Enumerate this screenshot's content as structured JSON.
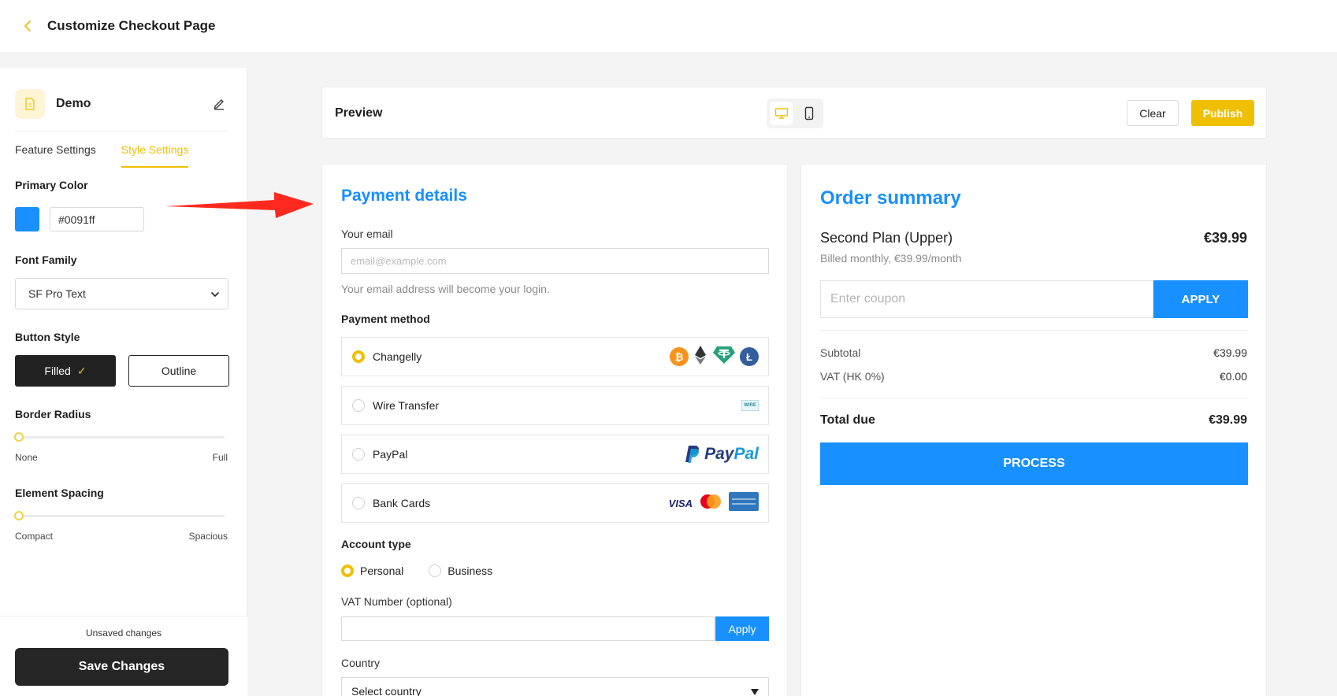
{
  "header": {
    "title": "Customize Checkout Page"
  },
  "sidebar": {
    "project_name": "Demo",
    "tabs": [
      {
        "label": "Feature Settings",
        "active": false
      },
      {
        "label": "Style Settings",
        "active": true
      }
    ],
    "primary_color": {
      "label": "Primary Color",
      "swatch": "#1890ff",
      "value": "#0091ff"
    },
    "font_family": {
      "label": "Font Family",
      "selected": "SF Pro Text"
    },
    "button_style": {
      "label": "Button Style",
      "filled": "Filled",
      "outline": "Outline",
      "selected": "Filled"
    },
    "border_radius": {
      "label": "Border Radius",
      "min": "None",
      "max": "Full",
      "value": 0
    },
    "element_spacing": {
      "label": "Element Spacing",
      "min": "Compact",
      "max": "Spacious",
      "value": 0
    },
    "footer": {
      "status": "Unsaved changes",
      "save_label": "Save Changes"
    }
  },
  "preview": {
    "title": "Preview",
    "device": "desktop",
    "clear_label": "Clear",
    "publish_label": "Publish"
  },
  "payment": {
    "title": "Payment details",
    "email_label": "Your email",
    "email_placeholder": "email@example.com",
    "email_hint": "Your email address will become your login.",
    "method_label": "Payment method",
    "methods": [
      {
        "name": "Changelly",
        "selected": true
      },
      {
        "name": "Wire Transfer",
        "selected": false
      },
      {
        "name": "PayPal",
        "selected": false
      },
      {
        "name": "Bank Cards",
        "selected": false
      }
    ],
    "logos": {
      "paypal_pay": "Pay",
      "paypal_pal": "Pal",
      "visa": "VISA",
      "wire": "WIRE"
    },
    "account_type_label": "Account type",
    "account_types": [
      "Personal",
      "Business"
    ],
    "account_selected": "Personal",
    "vat_label": "VAT Number (optional)",
    "vat_apply": "Apply",
    "country_label": "Country",
    "country_placeholder": "Select country"
  },
  "order": {
    "title": "Order summary",
    "plan_name": "Second Plan (Upper)",
    "plan_price": "€39.99",
    "billed": "Billed monthly, €39.99/month",
    "coupon_placeholder": "Enter coupon",
    "coupon_apply": "APPLY",
    "subtotal_label": "Subtotal",
    "subtotal_value": "€39.99",
    "vat_label": "VAT (HK 0%)",
    "vat_value": "€0.00",
    "total_label": "Total due",
    "total_value": "€39.99",
    "process_label": "PROCESS"
  },
  "colors": {
    "accent": "#efbf04",
    "primary": "#1890ff",
    "annotation_arrow": "#ff2a1f"
  }
}
